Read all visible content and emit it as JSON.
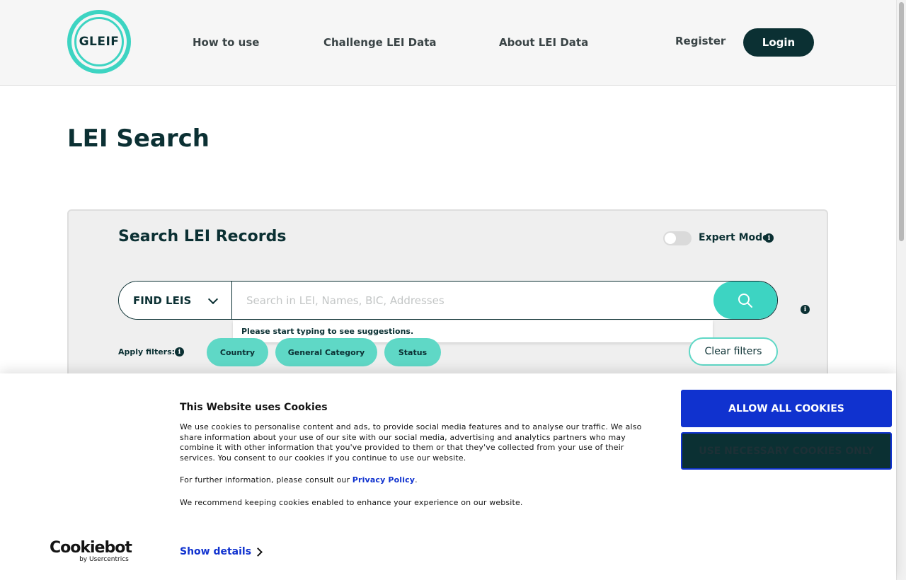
{
  "header": {
    "logo_text": "GLEIF",
    "nav": [
      "How to use",
      "Challenge LEI Data",
      "About LEI Data"
    ],
    "register_label": "Register",
    "login_label": "Login"
  },
  "page": {
    "title": "LEI Search"
  },
  "search_panel": {
    "title": "Search LEI Records",
    "expert_mode_label": "Expert Mode",
    "expert_mode_on": false,
    "find_select_value": "FIND LEIS",
    "search_placeholder": "Search in LEI, Names, BIC, Addresses",
    "suggestion_hint": "Please start typing to see suggestions.",
    "apply_filters_label": "Apply filters:",
    "filters": [
      "Country",
      "General Category",
      "Status"
    ],
    "clear_filters_label": "Clear filters"
  },
  "cookie_banner": {
    "title": "This Website uses Cookies",
    "paragraph1": "We use cookies to personalise content and ads, to provide social media features and to analyse our traffic. We also share information about your use of our site with our social media, advertising and analytics partners who may combine it with other information that you've provided to them or that they've collected from your use of their services. You consent to our cookies if you continue to use our website.",
    "paragraph2_prefix": "For further information, please consult our ",
    "privacy_link": "Privacy Policy",
    "paragraph2_suffix": ".",
    "paragraph3": "We recommend keeping cookies enabled to enhance your experience on our website.",
    "allow_all_label": "ALLOW ALL COOKIES",
    "necessary_label": "USE NECESSARY COOKIES ONLY",
    "show_details_label": "Show details",
    "cookiebot_brand": "Cookiebot",
    "cookiebot_sub": "by Usercentrics"
  },
  "colors": {
    "brand_dark": "#0b3033",
    "brand_teal": "#3dd4c2",
    "cookie_blue": "#1032cf"
  }
}
